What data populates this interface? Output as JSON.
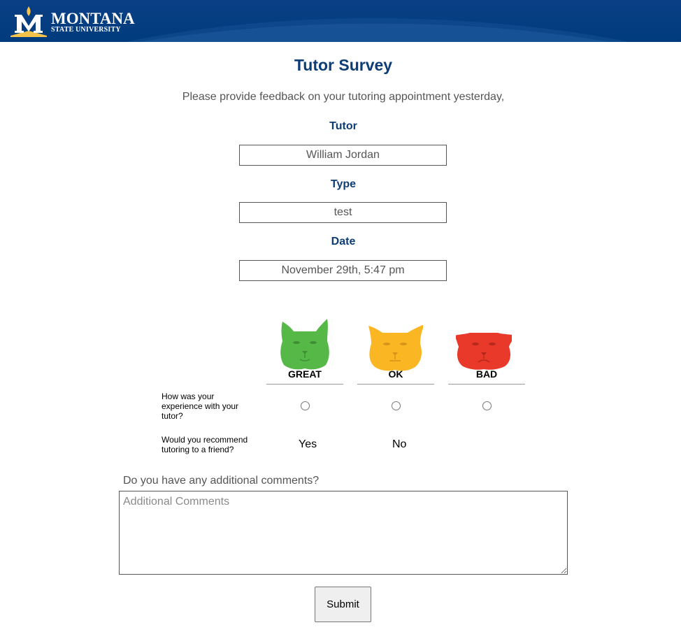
{
  "header": {
    "logo_line1": "MONTANA",
    "logo_line2": "STATE UNIVERSITY",
    "brand_color": "#003c7d",
    "accent_gold": "#f5c24a"
  },
  "survey": {
    "title": "Tutor Survey",
    "intro": "Please provide feedback on your tutoring appointment yesterday,",
    "fields": {
      "tutor_label": "Tutor",
      "tutor_value": "William Jordan",
      "type_label": "Type",
      "type_value": "test",
      "date_label": "Date",
      "date_value": "November 29th, 5:47 pm"
    },
    "ratings": [
      {
        "label": "GREAT",
        "color": "#55b847",
        "icon": "bobcat-great-icon"
      },
      {
        "label": "OK",
        "color": "#fbb723",
        "icon": "bobcat-ok-icon"
      },
      {
        "label": "BAD",
        "color": "#e8392a",
        "icon": "bobcat-bad-icon"
      }
    ],
    "question_experience": "How was your experience with your tutor?",
    "question_recommend": "Would you recommend tutoring to a friend?",
    "answer_yes": "Yes",
    "answer_no": "No",
    "comments_label": "Do you have any additional comments?",
    "comments_placeholder": "Additional Comments",
    "submit_label": "Submit"
  }
}
